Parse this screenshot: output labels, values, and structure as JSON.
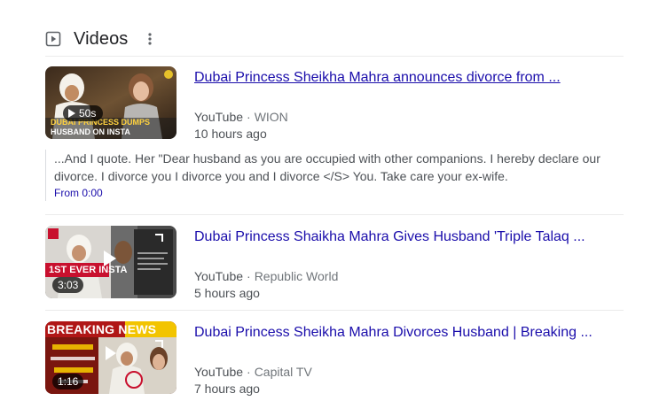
{
  "section": {
    "title": "Videos",
    "icon": "play-box-icon",
    "more_icon": "more-vert-icon"
  },
  "videos": [
    {
      "title": "Dubai Princess Sheikha Mahra announces divorce from ...",
      "source": "YouTube",
      "channel": "WION",
      "age": "10 hours ago",
      "duration": "50s",
      "thumb_caption_1": "DUBAI PRINCESS DUMPS",
      "thumb_caption_2": "HUSBAND ON INSTA",
      "snippet": "...And I quote. Her \"Dear husband as you are occupied with other companions. I hereby declare our divorce. I divorce you I divorce you and I divorce </S> You. Take care your ex-wife.",
      "snippet_link": "From 0:00"
    },
    {
      "title": "Dubai Princess Shaikha Mahra Gives Husband 'Triple Talaq ...",
      "source": "YouTube",
      "channel": "Republic World",
      "age": "5 hours ago",
      "duration": "3:03",
      "thumb_caption_1": "1ST EVER INSTA"
    },
    {
      "title": "Dubai Princess Sheikha Mahra Divorces Husband | Breaking ...",
      "source": "YouTube",
      "channel": "Capital TV",
      "age": "7 hours ago",
      "duration": "1:16",
      "thumb_caption_1": "BREAKING NEWS"
    }
  ],
  "colors": {
    "link": "#1a0dab",
    "meta": "#4d5156",
    "divider": "#ebebeb"
  }
}
